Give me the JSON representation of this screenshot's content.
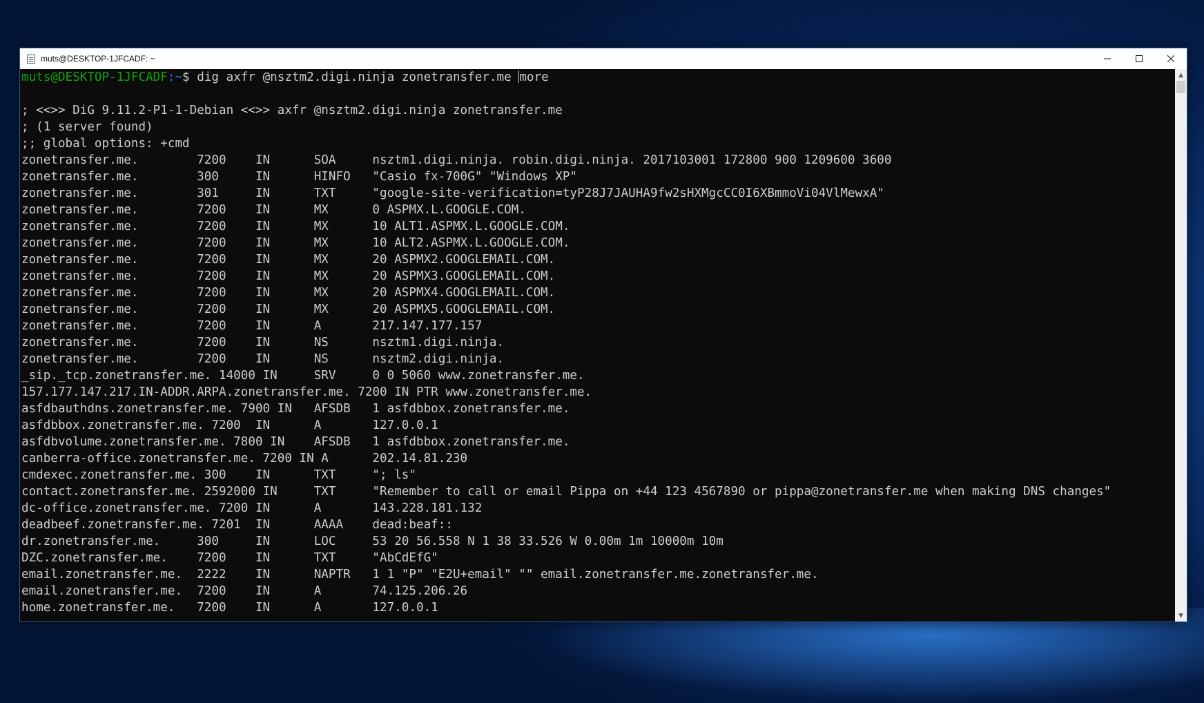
{
  "window": {
    "title": "muts@DESKTOP-1JFCADF: ~",
    "minimize_label": "─",
    "maximize_label": "☐",
    "close_label": "✕"
  },
  "prompt": {
    "user_host": "muts@DESKTOP-1JFCADF",
    "path": ":~",
    "symbol": "$ ",
    "command": "dig axfr @nsztm2.digi.ninja zonetransfer.me ",
    "pipe": "more"
  },
  "output": [
    "",
    "; <<>> DiG 9.11.2-P1-1-Debian <<>> axfr @nsztm2.digi.ninja zonetransfer.me",
    "; (1 server found)",
    ";; global options: +cmd",
    "zonetransfer.me.        7200    IN      SOA     nsztm1.digi.ninja. robin.digi.ninja. 2017103001 172800 900 1209600 3600",
    "zonetransfer.me.        300     IN      HINFO   \"Casio fx-700G\" \"Windows XP\"",
    "zonetransfer.me.        301     IN      TXT     \"google-site-verification=tyP28J7JAUHA9fw2sHXMgcCC0I6XBmmoVi04VlMewxA\"",
    "zonetransfer.me.        7200    IN      MX      0 ASPMX.L.GOOGLE.COM.",
    "zonetransfer.me.        7200    IN      MX      10 ALT1.ASPMX.L.GOOGLE.COM.",
    "zonetransfer.me.        7200    IN      MX      10 ALT2.ASPMX.L.GOOGLE.COM.",
    "zonetransfer.me.        7200    IN      MX      20 ASPMX2.GOOGLEMAIL.COM.",
    "zonetransfer.me.        7200    IN      MX      20 ASPMX3.GOOGLEMAIL.COM.",
    "zonetransfer.me.        7200    IN      MX      20 ASPMX4.GOOGLEMAIL.COM.",
    "zonetransfer.me.        7200    IN      MX      20 ASPMX5.GOOGLEMAIL.COM.",
    "zonetransfer.me.        7200    IN      A       217.147.177.157",
    "zonetransfer.me.        7200    IN      NS      nsztm1.digi.ninja.",
    "zonetransfer.me.        7200    IN      NS      nsztm2.digi.ninja.",
    "_sip._tcp.zonetransfer.me. 14000 IN     SRV     0 0 5060 www.zonetransfer.me.",
    "157.177.147.217.IN-ADDR.ARPA.zonetransfer.me. 7200 IN PTR www.zonetransfer.me.",
    "asfdbauthdns.zonetransfer.me. 7900 IN   AFSDB   1 asfdbbox.zonetransfer.me.",
    "asfdbbox.zonetransfer.me. 7200  IN      A       127.0.0.1",
    "asfdbvolume.zonetransfer.me. 7800 IN    AFSDB   1 asfdbbox.zonetransfer.me.",
    "canberra-office.zonetransfer.me. 7200 IN A      202.14.81.230",
    "cmdexec.zonetransfer.me. 300    IN      TXT     \"; ls\"",
    "contact.zonetransfer.me. 2592000 IN     TXT     \"Remember to call or email Pippa on +44 123 4567890 or pippa@zonetransfer.me when making DNS changes\"",
    "dc-office.zonetransfer.me. 7200 IN      A       143.228.181.132",
    "deadbeef.zonetransfer.me. 7201  IN      AAAA    dead:beaf::",
    "dr.zonetransfer.me.     300     IN      LOC     53 20 56.558 N 1 38 33.526 W 0.00m 1m 10000m 10m",
    "DZC.zonetransfer.me.    7200    IN      TXT     \"AbCdEfG\"",
    "email.zonetransfer.me.  2222    IN      NAPTR   1 1 \"P\" \"E2U+email\" \"\" email.zonetransfer.me.zonetransfer.me.",
    "email.zonetransfer.me.  7200    IN      A       74.125.206.26",
    "home.zonetransfer.me.   7200    IN      A       127.0.0.1"
  ],
  "scrollbar": {
    "up_arrow": "▲",
    "down_arrow": "▼"
  },
  "icons": {
    "window_icon": "terminal-icon"
  }
}
